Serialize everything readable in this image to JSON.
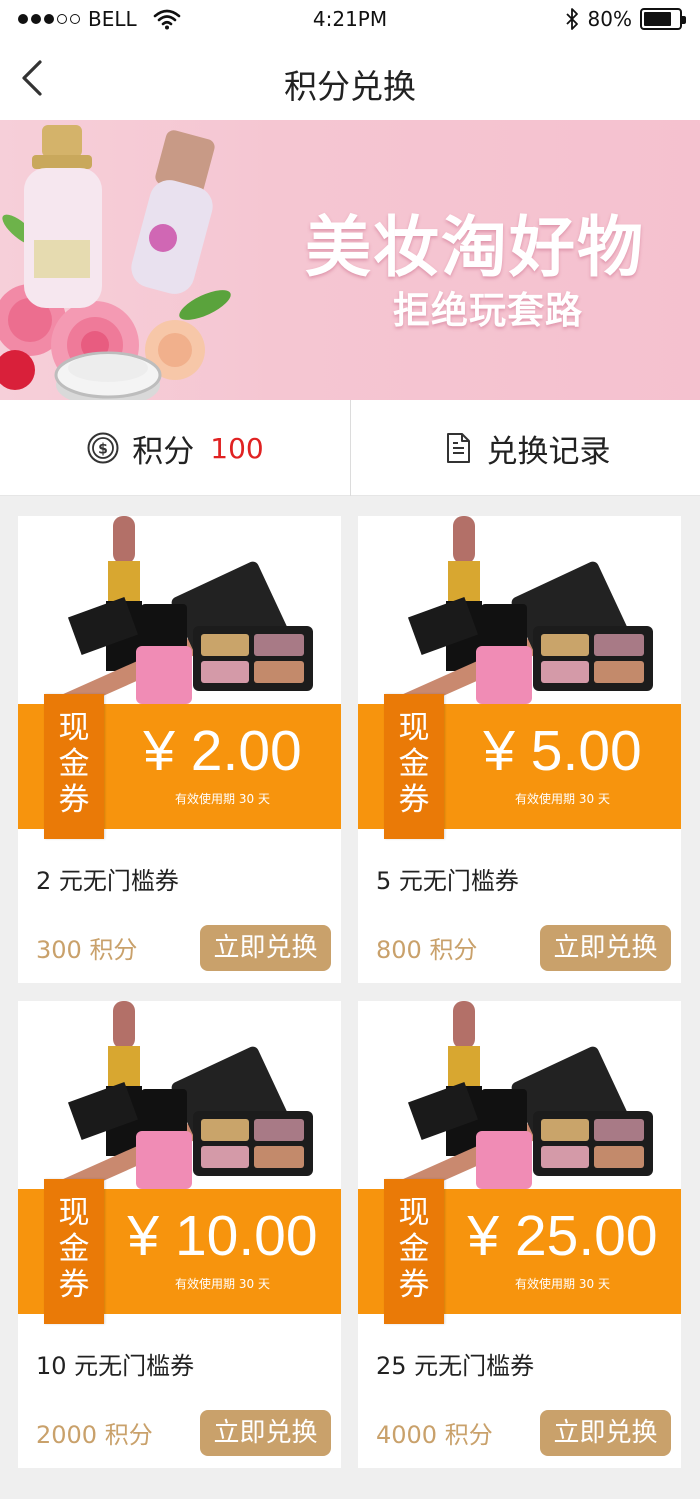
{
  "status_bar": {
    "carrier": "BELL",
    "time": "4:21PM",
    "battery": "80%",
    "battery_level": 0.8
  },
  "nav": {
    "title": "积分兑换"
  },
  "banner": {
    "title": "美妆淘好物",
    "subtitle": "拒绝玩套路"
  },
  "info": {
    "points_label": "积分",
    "points_value": "100",
    "records_label": "兑换记录"
  },
  "cards": [
    {
      "tag": [
        "现",
        "金",
        "券"
      ],
      "amount": "¥ 2.00",
      "validity": "有效使用期 30 天",
      "name": "2 元无门槛券",
      "points": "300 积分",
      "button": "立即兑换"
    },
    {
      "tag": [
        "现",
        "金",
        "券"
      ],
      "amount": "¥ 5.00",
      "validity": "有效使用期 30 天",
      "name": "5 元无门槛券",
      "points": "800 积分",
      "button": "立即兑换"
    },
    {
      "tag": [
        "现",
        "金",
        "券"
      ],
      "amount": "¥ 10.00",
      "validity": "有效使用期 30 天",
      "name": "10 元无门槛券",
      "points": "2000 积分",
      "button": "立即兑换"
    },
    {
      "tag": [
        "现",
        "金",
        "券"
      ],
      "amount": "¥ 25.00",
      "validity": "有效使用期 30 天",
      "name": "25 元无门槛券",
      "points": "4000 积分",
      "button": "立即兑换"
    }
  ],
  "colors": {
    "coupon_orange": "#f7940d",
    "coupon_tag": "#ea7a07",
    "gold": "#c9a16b",
    "points_red": "#e02222",
    "banner_pink": "#f5c6d2"
  },
  "icons": {
    "back": "chevron-left-icon",
    "coin": "coin-icon",
    "document": "document-icon",
    "wifi": "wifi-icon",
    "bluetooth": "bluetooth-icon",
    "battery": "battery-icon"
  }
}
